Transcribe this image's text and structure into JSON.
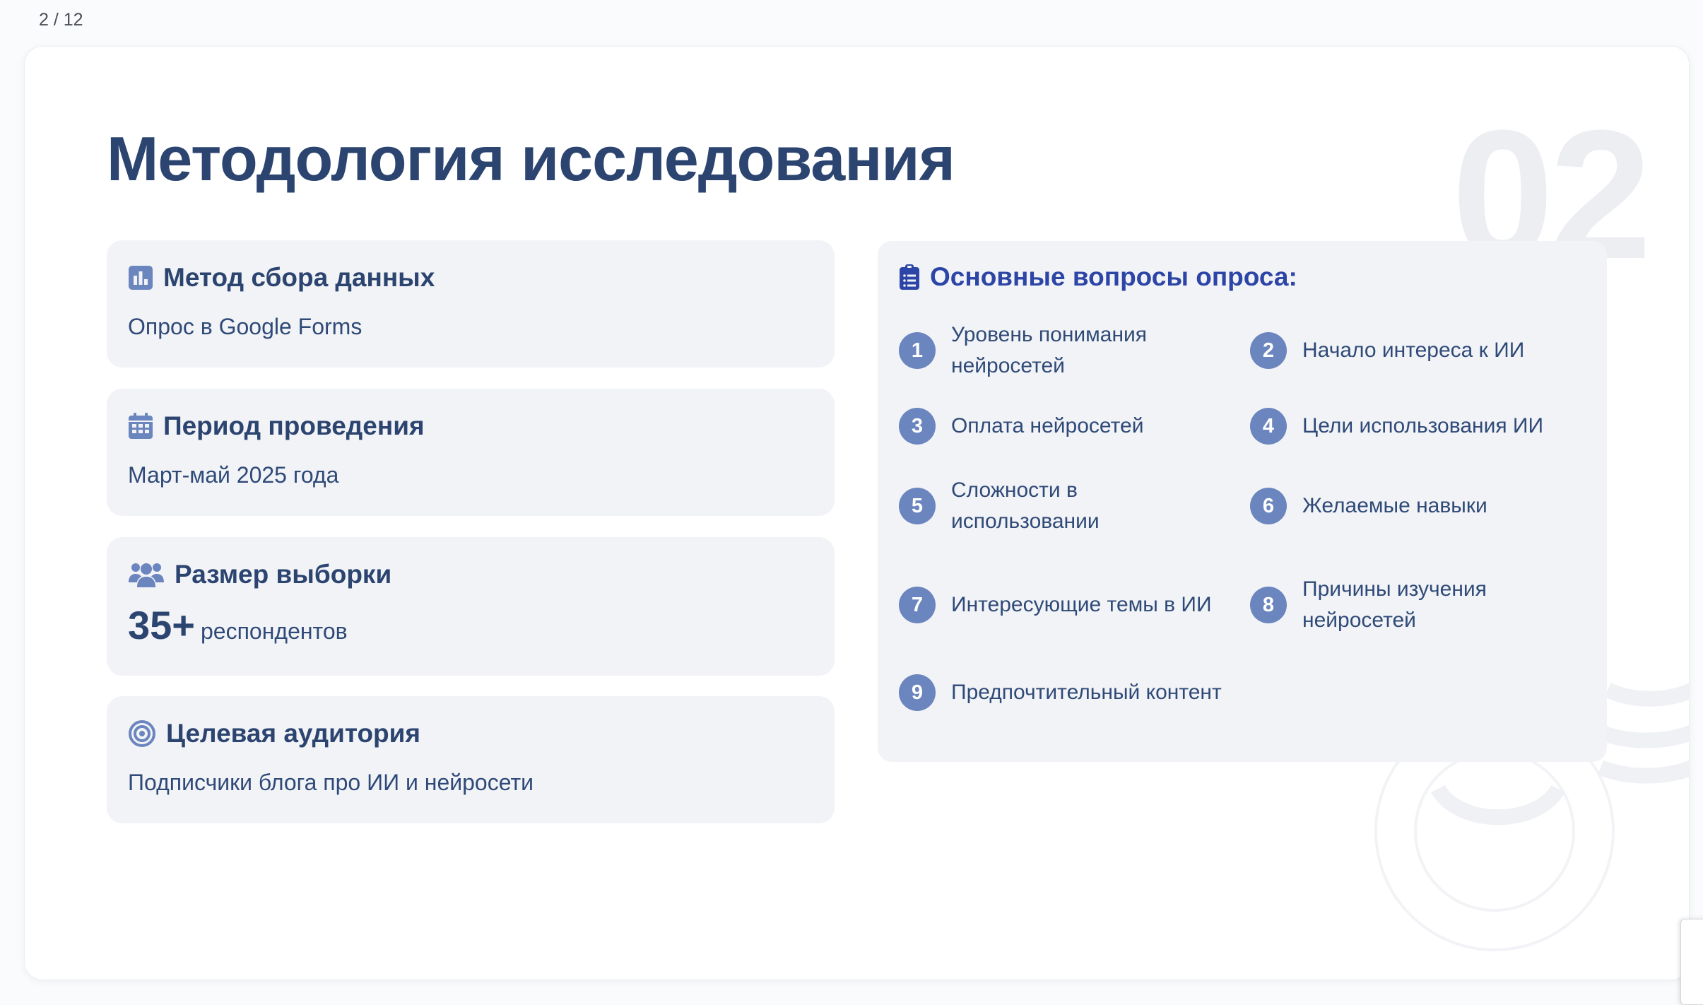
{
  "page_counter": "2 / 12",
  "slide": {
    "number": "02",
    "title": "Методология исследования"
  },
  "info_cards": {
    "method": {
      "title": "Метод сбора данных",
      "value": "Опрос в Google Forms",
      "icon": "bar-chart-icon"
    },
    "period": {
      "title": "Период проведения",
      "value": "Март-май 2025 года",
      "icon": "calendar-icon"
    },
    "sample": {
      "title": "Размер выборки",
      "value_number": "35+",
      "value_unit": "респондентов",
      "icon": "users-icon"
    },
    "audience": {
      "title": "Целевая аудитория",
      "value": "Подписчики блога про ИИ и нейросети",
      "icon": "target-icon"
    }
  },
  "questions": {
    "title": "Основные вопросы опроса:",
    "icon": "clipboard-list-icon",
    "items": [
      {
        "num": "1",
        "text": "Уровень понимания нейросетей"
      },
      {
        "num": "2",
        "text": "Начало интереса к ИИ"
      },
      {
        "num": "3",
        "text": "Оплата нейросетей"
      },
      {
        "num": "4",
        "text": "Цели использования ИИ"
      },
      {
        "num": "5",
        "text": "Сложности в использовании"
      },
      {
        "num": "6",
        "text": "Желаемые навыки"
      },
      {
        "num": "7",
        "text": "Интересующие темы в ИИ"
      },
      {
        "num": "8",
        "text": "Причины изучения нейросетей"
      },
      {
        "num": "9",
        "text": "Предпочтительный контент"
      }
    ]
  },
  "colors": {
    "title": "#2c4470",
    "accent": "#2c45a6",
    "badge": "#6b85bf",
    "icon": "#6b85bf",
    "card_bg": "#f2f3f6"
  }
}
